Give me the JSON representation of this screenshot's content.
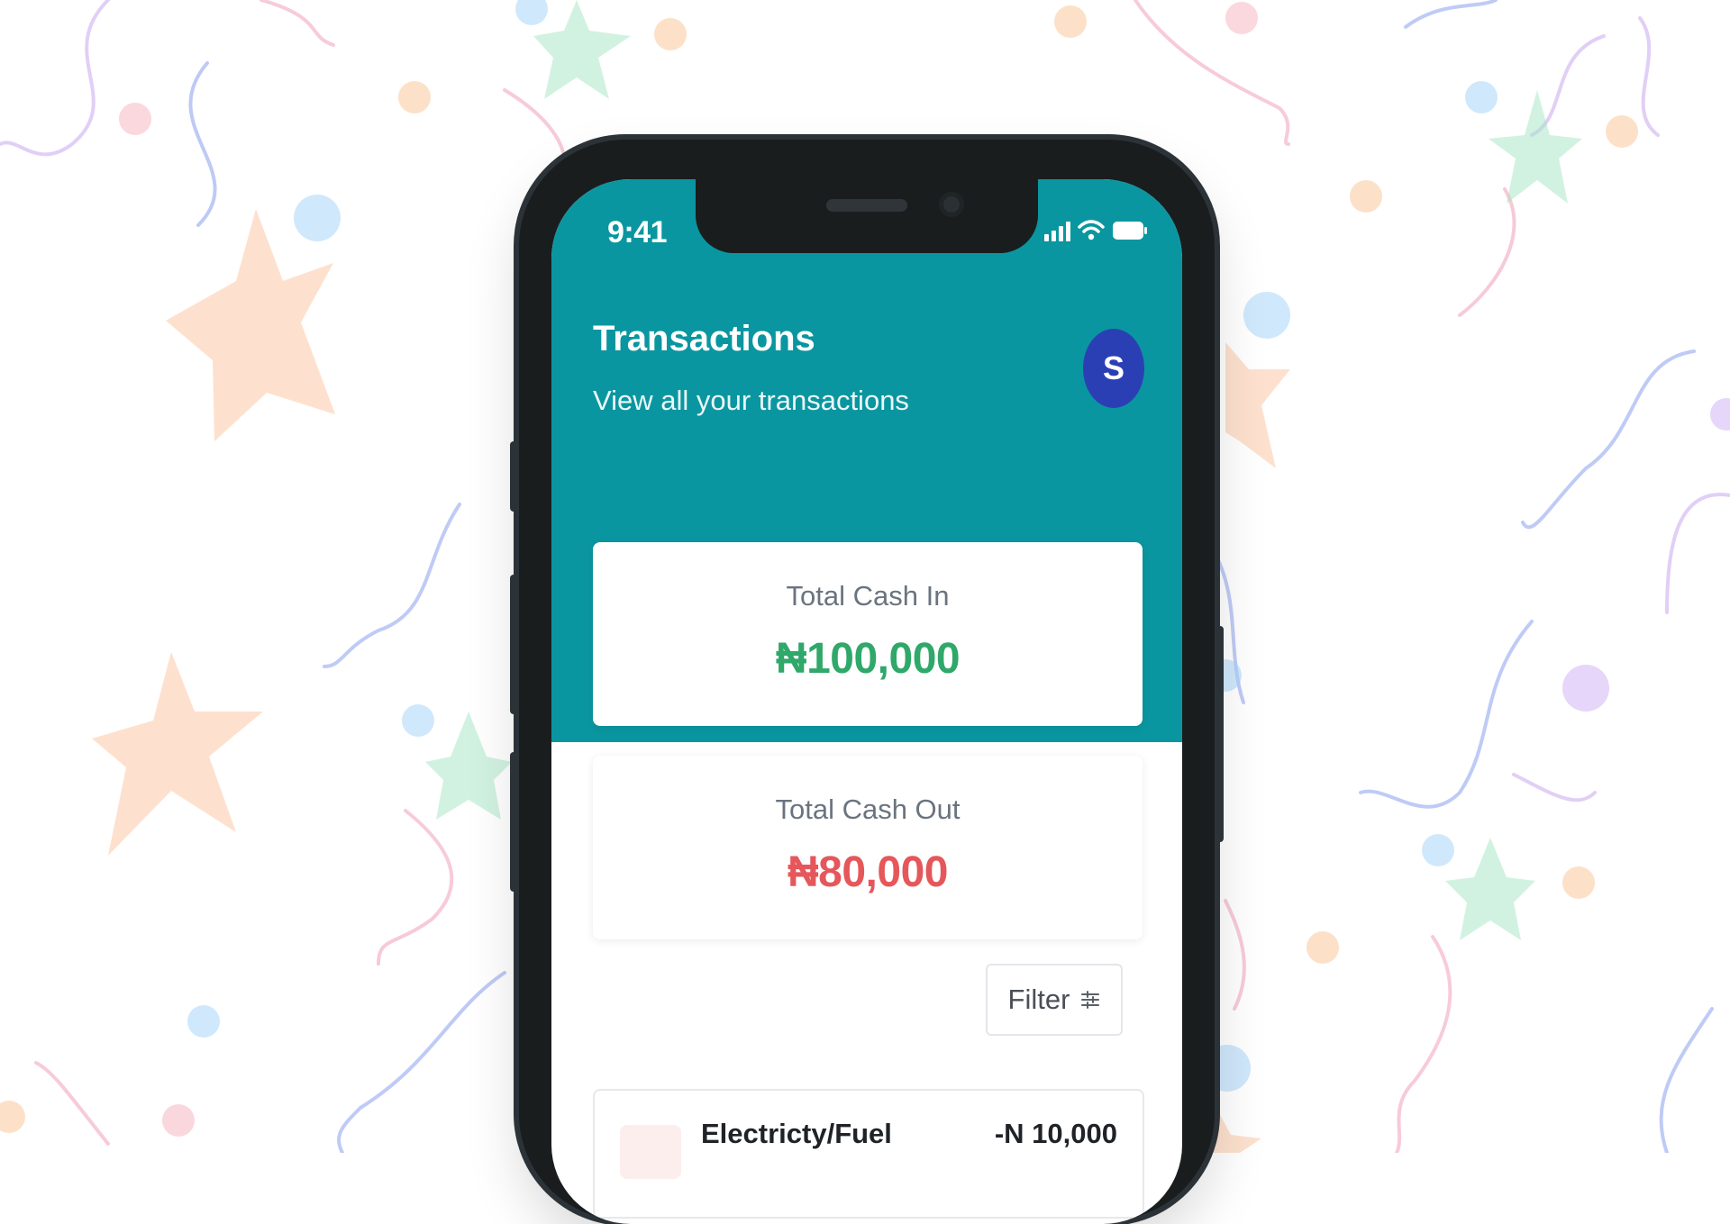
{
  "status_bar": {
    "time": "9:41"
  },
  "header": {
    "title": "Transactions",
    "subtitle": "View all your transactions",
    "avatar_initial": "S"
  },
  "summary": {
    "cash_in": {
      "label": "Total Cash In",
      "amount": "₦100,000",
      "color": "#2fa86a"
    },
    "cash_out": {
      "label": "Total Cash Out",
      "amount": "₦80,000",
      "color": "#e5575a"
    }
  },
  "filter": {
    "label": "Filter",
    "icon": "sliders-icon"
  },
  "transactions": [
    {
      "label": "Electricty/Fuel",
      "amount": "-N 10,000"
    }
  ],
  "colors": {
    "header": "#0a96a0",
    "avatar": "#2b3fb5"
  }
}
